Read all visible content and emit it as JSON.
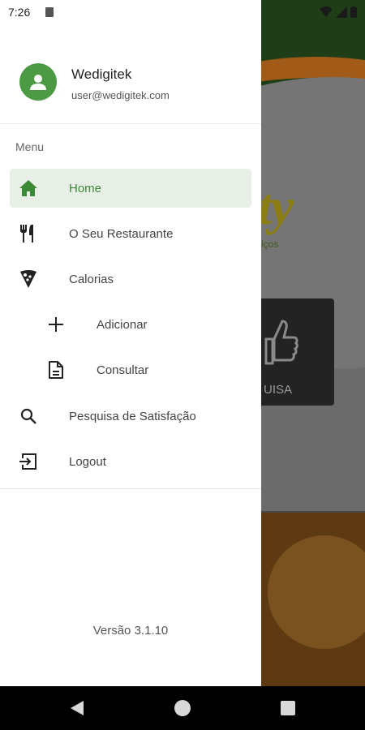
{
  "status_bar": {
    "time": "7:26"
  },
  "account": {
    "name": "Wedigitek",
    "email": "user@wedigitek.com"
  },
  "menu_heading": "Menu",
  "nav": [
    {
      "label": "Home",
      "icon": "home-icon",
      "active": true
    },
    {
      "label": "O Seu Restaurante",
      "icon": "restaurant-icon"
    },
    {
      "label": "Calorias",
      "icon": "pizza-icon"
    },
    {
      "label": "Adicionar",
      "icon": "plus-icon"
    },
    {
      "label": "Consultar",
      "icon": "document-icon"
    },
    {
      "label": "Pesquisa de Satisfação",
      "icon": "search-icon"
    },
    {
      "label": "Logout",
      "icon": "logout-icon"
    }
  ],
  "version": "Versão 3.1.10",
  "background": {
    "brand": "ty",
    "brand_sub": "iços",
    "card_label": "UISA"
  },
  "colors": {
    "accent": "#3d8a36",
    "active_bg": "#e8efe6",
    "avatar": "#4c9a44"
  }
}
